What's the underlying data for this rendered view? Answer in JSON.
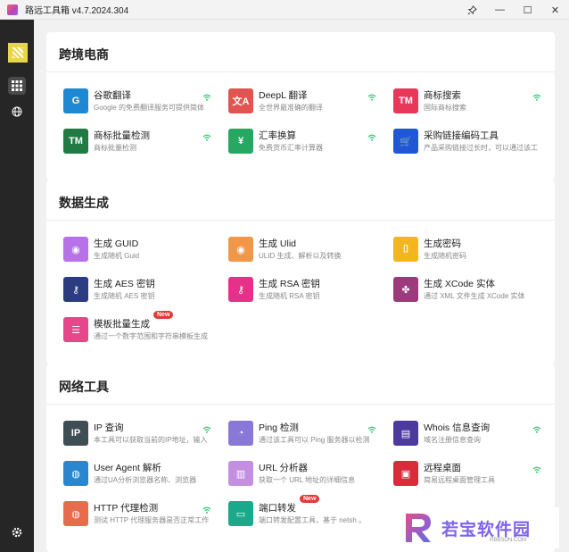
{
  "window": {
    "title": "路远工具箱 v4.7.2024.304",
    "pin_glyph": "⊹",
    "minimize_glyph": "—",
    "maximize_glyph": "☐",
    "close_glyph": "✕"
  },
  "sections": [
    {
      "title": "跨境电商",
      "items": [
        {
          "name": "谷歌翻译",
          "desc": "Google 的免费翻译服务可提供简体",
          "icon": "google-translate-icon",
          "color": "#1e88d2",
          "glyph": "G",
          "wifi": true
        },
        {
          "name": "DeepL 翻译",
          "desc": "全世界最准确的翻译",
          "icon": "translate-icon",
          "color": "#e0554f",
          "glyph": "文A",
          "wifi": true
        },
        {
          "name": "商标搜索",
          "desc": "国际商标搜索",
          "icon": "trademark-icon",
          "color": "#e9375a",
          "glyph": "TM",
          "wifi": true
        },
        {
          "name": "商标批量检测",
          "desc": "商标批量检测",
          "icon": "trademark-icon",
          "color": "#1f7a43",
          "glyph": "TM",
          "wifi": true
        },
        {
          "name": "汇率换算",
          "desc": "免费货币汇率计算器",
          "icon": "yuan-icon",
          "color": "#26a862",
          "glyph": "¥",
          "wifi": true
        },
        {
          "name": "采购链接编码工具",
          "desc": "产品采购链接过长时，可以通过该工",
          "icon": "cart-icon",
          "color": "#2157d6",
          "glyph": "🛒",
          "wifi": false
        }
      ]
    },
    {
      "title": "数据生成",
      "items": [
        {
          "name": "生成 GUID",
          "desc": "生成随机 Guid",
          "icon": "globe-icon",
          "color": "#b872e8",
          "glyph": "◉",
          "wifi": false,
          "new": false
        },
        {
          "name": "生成 Ulid",
          "desc": "ULID 生成、解析以及转换",
          "icon": "globe-icon",
          "color": "#f0974a",
          "glyph": "◉",
          "wifi": false,
          "new": false
        },
        {
          "name": "生成密码",
          "desc": "生成随机密码",
          "icon": "password-icon",
          "color": "#f2b71f",
          "glyph": "⌷",
          "wifi": false,
          "new": false
        },
        {
          "name": "生成 AES 密钥",
          "desc": "生成随机 AES 密钥",
          "icon": "key-icon",
          "color": "#2b3c80",
          "glyph": "⚷",
          "wifi": false,
          "new": false
        },
        {
          "name": "生成 RSA 密钥",
          "desc": "生成随机 RSA 密钥",
          "icon": "key-plus-icon",
          "color": "#e5318a",
          "glyph": "⚷",
          "wifi": false,
          "new": false
        },
        {
          "name": "生成 XCode 实体",
          "desc": "通过 XML 文件生成 XCode 实体",
          "icon": "clover-icon",
          "color": "#9c3a7e",
          "glyph": "✤",
          "wifi": false,
          "new": false
        },
        {
          "name": "模板批量生成",
          "desc": "通过一个数字范围和字符串模板生成",
          "icon": "template-icon",
          "color": "#e8468a",
          "glyph": "☰",
          "wifi": false,
          "new": true
        }
      ]
    },
    {
      "title": "网络工具",
      "items": [
        {
          "name": "IP 查询",
          "desc": "本工具可以获取当前的IP地址，输入",
          "icon": "ip-icon",
          "color": "#3f4e55",
          "glyph": "IP",
          "wifi": true,
          "new": false
        },
        {
          "name": "Ping 检测",
          "desc": "通过该工具可以 Ping 服务器以检测",
          "icon": "gauge-icon",
          "color": "#8a78d8",
          "glyph": "◔",
          "wifi": true,
          "new": false
        },
        {
          "name": "Whois 信息查询",
          "desc": "域名注册信息查询",
          "icon": "id-card-icon",
          "color": "#4c3a9e",
          "glyph": "▤",
          "wifi": true,
          "new": false
        },
        {
          "name": "User Agent 解析",
          "desc": "通过UA分析浏览器名称、浏览器",
          "icon": "globe-icon",
          "color": "#2a86cf",
          "glyph": "◍",
          "wifi": false,
          "new": false
        },
        {
          "name": "URL 分析器",
          "desc": "获取一个 URL 地址的详细信息",
          "icon": "columns-icon",
          "color": "#c48fe0",
          "glyph": "▥",
          "wifi": false,
          "new": false
        },
        {
          "name": "远程桌面",
          "desc": "简易远程桌面管理工具",
          "icon": "remote-desktop-icon",
          "color": "#d92b3a",
          "glyph": "▣",
          "wifi": true,
          "new": false
        },
        {
          "name": "HTTP 代理检测",
          "desc": "测试 HTTP 代理服务器是否正常工作",
          "icon": "globe-icon",
          "color": "#e86b4b",
          "glyph": "◍",
          "wifi": true,
          "new": false
        },
        {
          "name": "端口转发",
          "desc": "端口转发配置工具，基于 netsh 。",
          "icon": "port-icon",
          "color": "#1aa98a",
          "glyph": "▭",
          "wifi": false,
          "new": true
        }
      ]
    }
  ],
  "badge_new": "New",
  "watermark": {
    "text": "若宝软件园",
    "sub": "RBBSON.COM"
  }
}
